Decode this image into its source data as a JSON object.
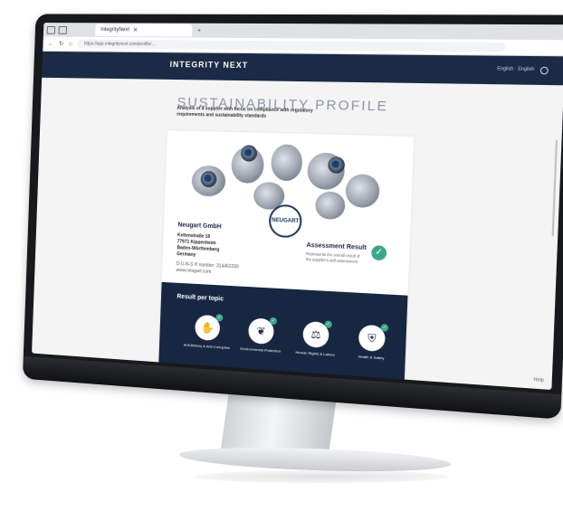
{
  "browser": {
    "tab_title": "IntegrityNext",
    "url": "https://app.integritynext.com/profile/…"
  },
  "header": {
    "logo_text": "INTEGRITY NEXT",
    "language": "English · English"
  },
  "page": {
    "title": "SUSTAINABILITY PROFILE",
    "subtitle": "Analysis of a supplier with focus on compliance with regulatory requirements and sustainability standards"
  },
  "company": {
    "name": "Neugart GmbH",
    "address_lines": [
      "Keltenstraße 16",
      "77971 Kippenheim",
      "Baden-Württemberg",
      "Germany"
    ],
    "duns": "D-U-N-S ® number: 314452250",
    "website": "www.neugart.com",
    "brand_badge": "NEUGART"
  },
  "assessment": {
    "title": "Assessment Result",
    "description": "Represents the overall result of the supplier's self-assessment"
  },
  "results": {
    "title": "Result per topic",
    "topics": [
      {
        "label": "Anti-Bribery & Anti-Corruption",
        "icon": "hand-coin-icon",
        "status": "ok"
      },
      {
        "label": "Environmental Protection",
        "icon": "leaf-icon",
        "status": "ok"
      },
      {
        "label": "Human Rights & Labour",
        "icon": "scale-icon",
        "status": "ok"
      },
      {
        "label": "Health & Safety",
        "icon": "shield-icon",
        "status": "ok"
      },
      {
        "label": "",
        "icon": "globe-icon",
        "status": "warn"
      },
      {
        "label": "",
        "icon": "arrow-icon",
        "status": "ok"
      },
      {
        "label": "",
        "icon": "lock-icon",
        "status": "ok"
      },
      {
        "label": "",
        "icon": "map-icon",
        "status": "ok"
      }
    ]
  },
  "corner_tag": "Help",
  "colors": {
    "navy": "#1b2a45",
    "green": "#3aa78d",
    "amber": "#f2b731"
  }
}
